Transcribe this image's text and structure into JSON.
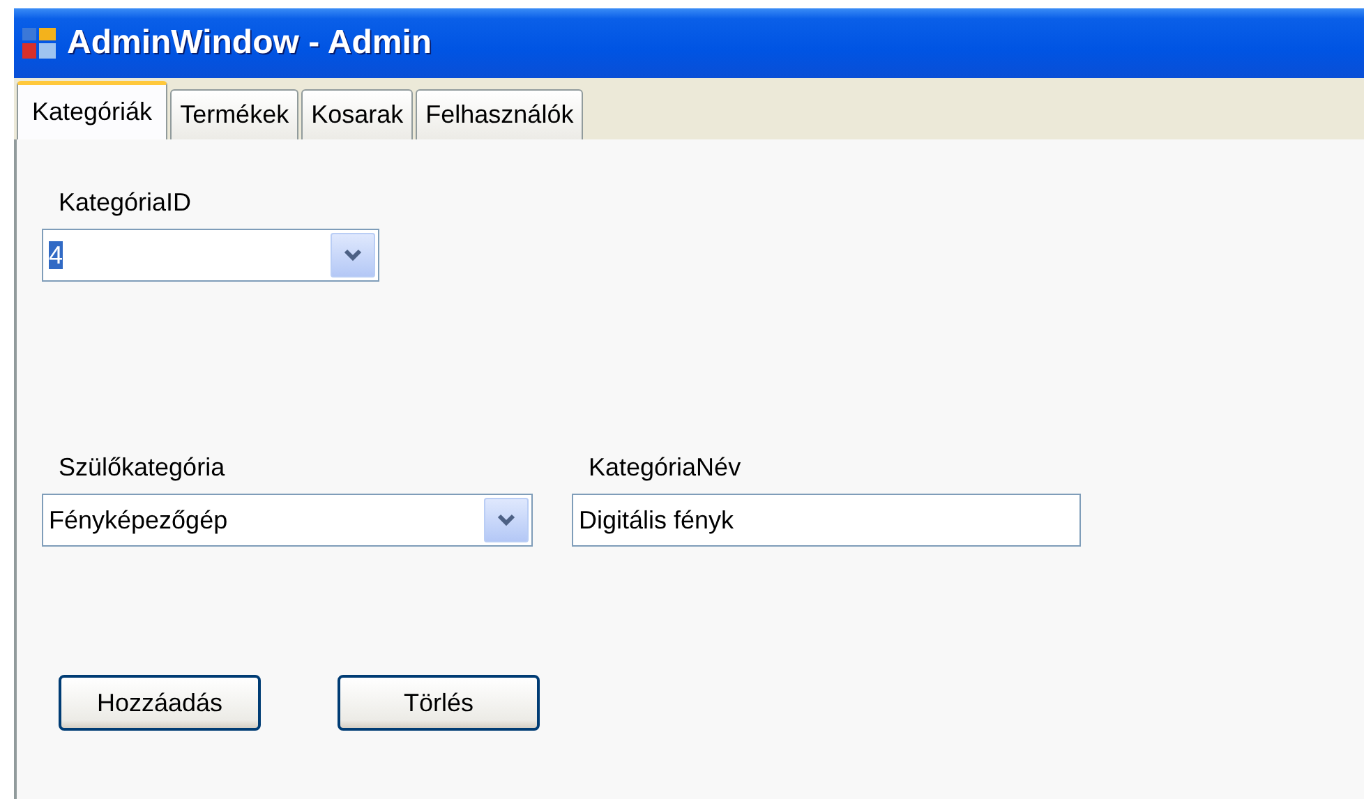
{
  "window": {
    "title": "AdminWindow - Admin"
  },
  "tabs": [
    {
      "label": "Kategóriák",
      "selected": true
    },
    {
      "label": "Termékek",
      "selected": false
    },
    {
      "label": "Kosarak",
      "selected": false
    },
    {
      "label": "Felhasználók",
      "selected": false
    }
  ],
  "fields": [
    {
      "kind": "combo",
      "label": "KategóriaID",
      "value": "4",
      "value_selected": true
    },
    {
      "kind": "combo",
      "label": "Szülőkategória",
      "value": "Fényképezőgép",
      "value_selected": false
    },
    {
      "kind": "text",
      "label": "KategóriaNév",
      "value": "Digitális fényk",
      "value_selected": false
    }
  ],
  "buttons": [
    "Hozzáadás",
    "Törlés"
  ]
}
